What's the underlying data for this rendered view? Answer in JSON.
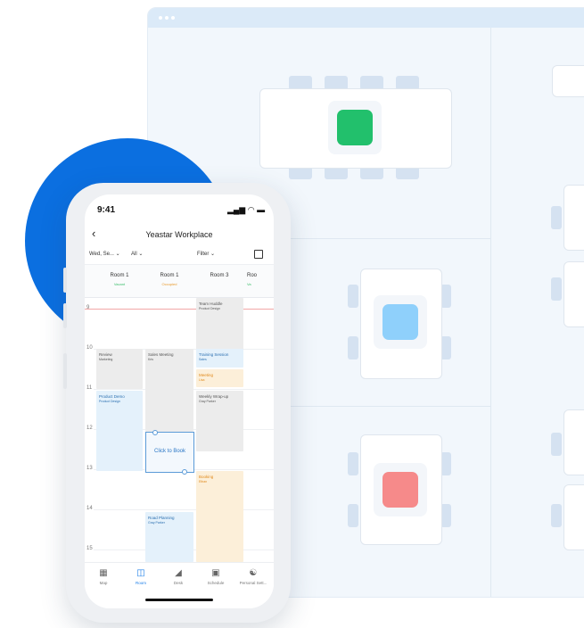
{
  "phone": {
    "status_time": "9:41",
    "status_icons": "▂▄▆ ◠ ▬",
    "back_icon": "chevron-left-icon",
    "title": "Yeastar Workplace",
    "filters": {
      "date": "Wed, Se...",
      "all": "All",
      "filter": "Filter"
    },
    "rooms": [
      {
        "name": "Room 1",
        "status": "Vacant",
        "color": "#3cbf6b"
      },
      {
        "name": "Room 1",
        "status": "Occupied",
        "color": "#e89a2c"
      },
      {
        "name": "Room 3",
        "status": "",
        "color": "#e89a2c"
      },
      {
        "name": "Roo",
        "status": "Va",
        "color": "#3cbf6b"
      }
    ],
    "hours": [
      "9",
      "10",
      "11",
      "12",
      "13",
      "14",
      "15"
    ],
    "events": {
      "team_huddle": {
        "name": "Team Huddle",
        "org": "Product Design"
      },
      "review": {
        "name": "Review",
        "org": "Marketing"
      },
      "sales_meeting": {
        "name": "Sales Meeting",
        "org": "Kris"
      },
      "training": {
        "name": "Training Session",
        "org": "Sales"
      },
      "meeting": {
        "name": "Meeting",
        "org": "Lisa"
      },
      "product_demo": {
        "name": "Product Demo",
        "org": "Product Design"
      },
      "weekly_wrap": {
        "name": "Weekly Wrap-up",
        "org": "Gray Parker"
      },
      "click_to_book": "Click to Book",
      "booking": {
        "name": "Booking",
        "org": "Ethan"
      },
      "road_planning": {
        "name": "Road Planning",
        "org": "Gray Parker"
      }
    },
    "tabs": [
      "Map",
      "Room",
      "Desk",
      "Schedule",
      "Personal Sett..."
    ]
  },
  "floor_plan": {
    "status_colors": {
      "green": "#22c06c",
      "blue": "#8fd0fb",
      "red": "#f68a8a"
    }
  }
}
